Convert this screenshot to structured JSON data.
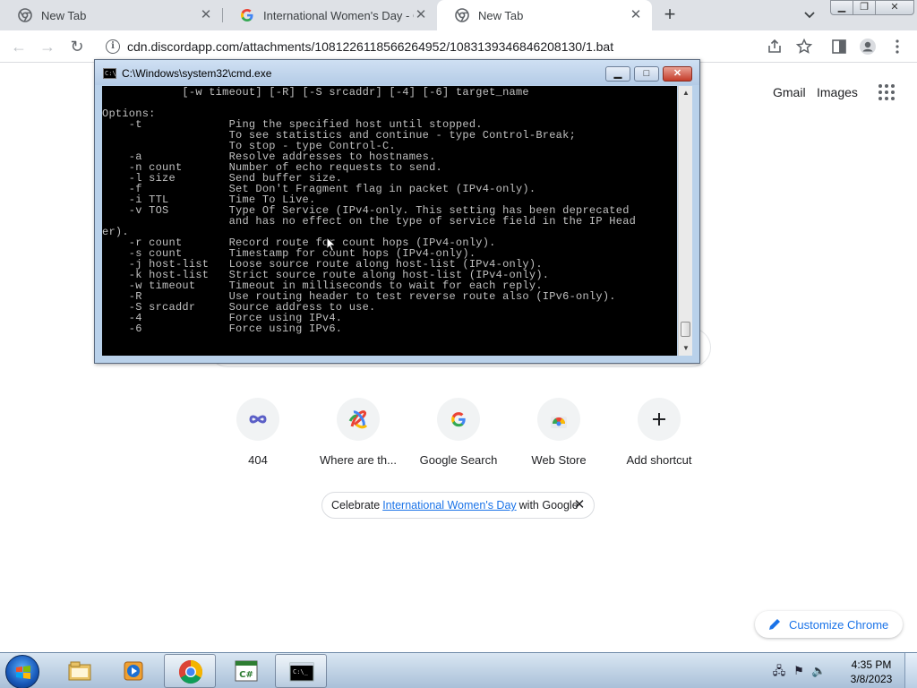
{
  "browser": {
    "tabs": [
      {
        "title": "New Tab",
        "active": false
      },
      {
        "title": "International Women's Day - Goo",
        "active": false
      },
      {
        "title": "New Tab",
        "active": true
      }
    ],
    "url": "cdn.discordapp.com/attachments/1081226118566264952/1083139346846208130/1.bat"
  },
  "ntp": {
    "gmail_label": "Gmail",
    "images_label": "Images",
    "shortcuts": [
      {
        "label": "404",
        "icon": "infinity-icon"
      },
      {
        "label": "Where are th...",
        "icon": "colorful-ribbon-icon"
      },
      {
        "label": "Google Search",
        "icon": "google-g-icon"
      },
      {
        "label": "Web Store",
        "icon": "web-store-icon"
      },
      {
        "label": "Add shortcut",
        "icon": "plus-icon"
      }
    ],
    "promo": {
      "prefix": "Celebrate",
      "link": "International Women's Day",
      "suffix": "with Google"
    },
    "customize_label": "Customize Chrome"
  },
  "cmd": {
    "title": "C:\\Windows\\system32\\cmd.exe",
    "output": "            [-w timeout] [-R] [-S srcaddr] [-4] [-6] target_name\n\nOptions:\n    -t             Ping the specified host until stopped.\n                   To see statistics and continue - type Control-Break;\n                   To stop - type Control-C.\n    -a             Resolve addresses to hostnames.\n    -n count       Number of echo requests to send.\n    -l size        Send buffer size.\n    -f             Set Don't Fragment flag in packet (IPv4-only).\n    -i TTL         Time To Live.\n    -v TOS         Type Of Service (IPv4-only. This setting has been deprecated\n                   and has no effect on the type of service field in the IP Head\ner).\n    -r count       Record route for count hops (IPv4-only).\n    -s count       Timestamp for count hops (IPv4-only).\n    -j host-list   Loose source route along host-list (IPv4-only).\n    -k host-list   Strict source route along host-list (IPv4-only).\n    -w timeout     Timeout in milliseconds to wait for each reply.\n    -R             Use routing header to test reverse route also (IPv6-only).\n    -S srcaddr     Source address to use.\n    -4             Force using IPv4.\n    -6             Force using IPv6."
  },
  "taskbar": {
    "apps": [
      "explorer-icon",
      "media-player-icon",
      "chrome-icon",
      "csharp-icon",
      "cmd-icon"
    ],
    "time": "4:35 PM",
    "date": "3/8/2023"
  },
  "colors": {
    "accent": "#1a73e8",
    "console_bg": "#000000",
    "console_fg": "#c0c0c0",
    "tabstrip": "#dee1e6"
  }
}
